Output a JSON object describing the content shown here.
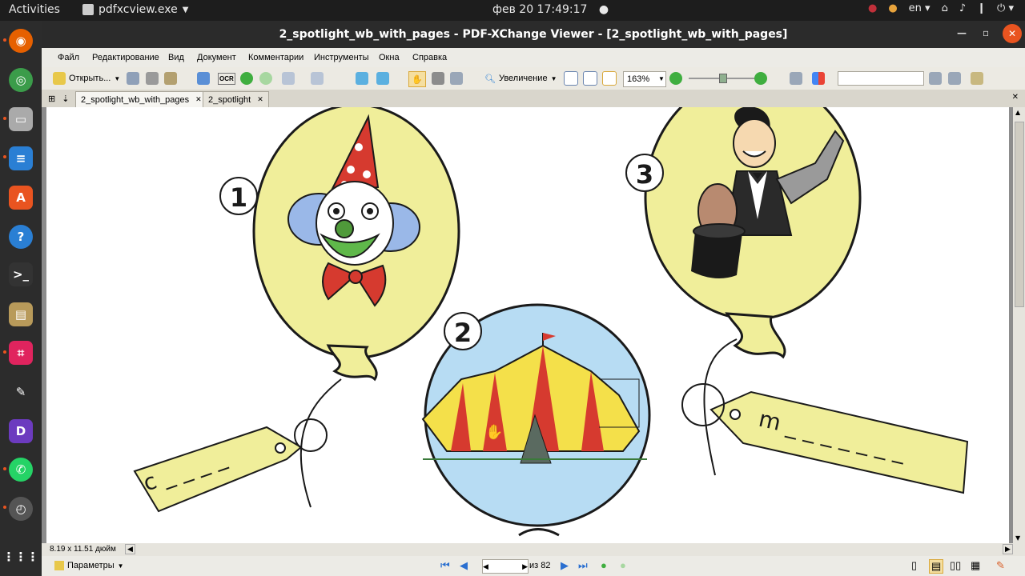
{
  "topbar": {
    "activities": "Activities",
    "app_name": "pdfxcview.exe",
    "clock": "фев 20  17:49:17",
    "lang": "en"
  },
  "window": {
    "title": "2_spotlight_wb_with_pages - PDF-XChange Viewer - [2_spotlight_wb_with_pages]"
  },
  "menu": [
    "Файл",
    "Редактирование",
    "Вид",
    "Документ",
    "Комментарии",
    "Инструменты",
    "Окна",
    "Справка"
  ],
  "toolbar": {
    "open_label": "Открыть...",
    "zoom_tool_label": "Увеличение",
    "zoom_value": "163%"
  },
  "tabs": [
    {
      "label": "2_spotlight_wb_with_pages"
    },
    {
      "label": "2_spotlight"
    }
  ],
  "page": {
    "balloon_numbers": [
      "1",
      "2",
      "3"
    ],
    "tag_left": "c _ _ _ _",
    "tag_right": "m _ _ _ _ _ _ _"
  },
  "statusbar": {
    "page_size": "8.19 x 11.51 дюйм",
    "params_label": "Параметры",
    "page_total": "из 82"
  },
  "colors": {
    "balloon_yellow": "#f0ee9a",
    "balloon_blue": "#b7dcf3",
    "titlebar": "#2b2b2b",
    "dock": "#2c2c2c"
  }
}
